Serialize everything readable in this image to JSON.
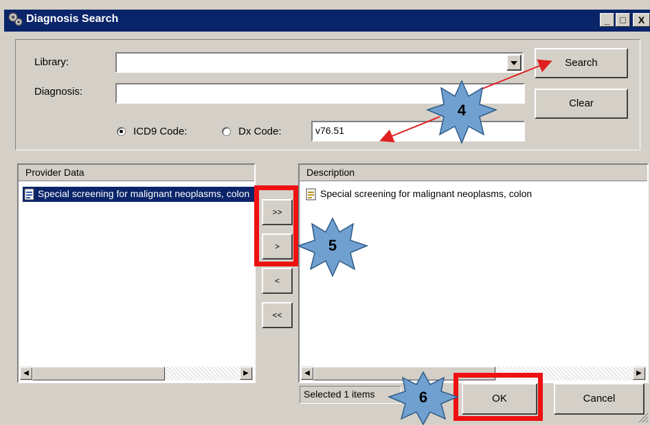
{
  "window": {
    "title": "Diagnosis Search",
    "controls": {
      "minimize": "_",
      "maximize": "□",
      "close": "X"
    }
  },
  "search": {
    "library_label": "Library:",
    "library_value": "",
    "diagnosis_label": "Diagnosis:",
    "diagnosis_value": "",
    "search_button": "Search",
    "clear_button": "Clear",
    "icd9_label": "ICD9 Code:",
    "icd9_selected": true,
    "dx_label": "Dx Code:",
    "dx_selected": false,
    "code_value": "v76.51"
  },
  "provider": {
    "header": "Provider Data",
    "items": [
      "Special screening for malignant neoplasms, colon"
    ]
  },
  "transfer": {
    "add_all": ">>",
    "add": ">",
    "remove": "<",
    "remove_all": "<<"
  },
  "description": {
    "header": "Description",
    "items": [
      "Special screening for malignant neoplasms, colon"
    ]
  },
  "footer": {
    "status": "Selected 1 items",
    "ok_button": "OK",
    "cancel_button": "Cancel"
  },
  "callouts": {
    "step4": "4",
    "step5": "5",
    "step6": "6",
    "star_color": "#6fa0d0",
    "highlight_color": "#ee1111",
    "arrow_color": "#e02020"
  },
  "colors": {
    "titlebar": "#0a246a",
    "selection": "#0a246a",
    "face": "#d4d0c8"
  }
}
